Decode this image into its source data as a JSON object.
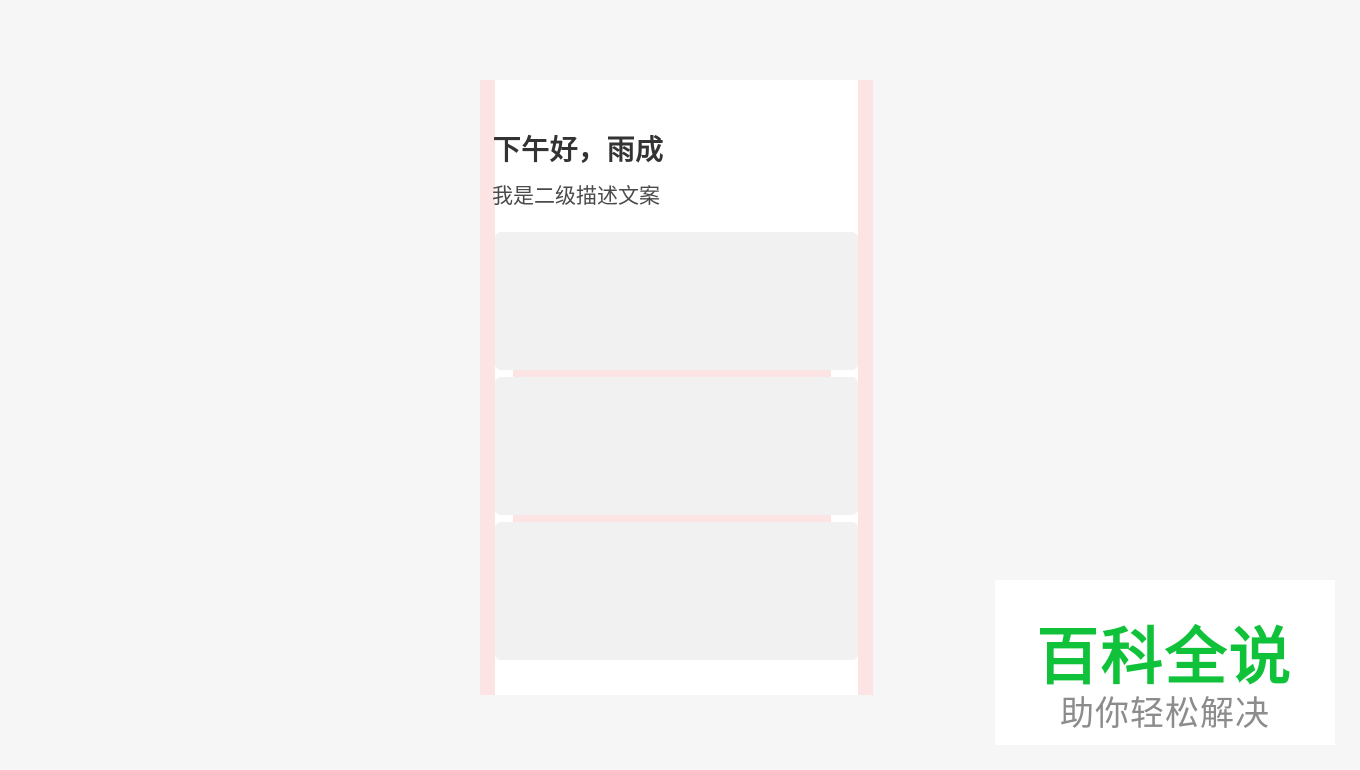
{
  "screen": {
    "greeting": "下午好，雨成",
    "subtitle": "我是二级描述文案",
    "cards": [
      "",
      "",
      ""
    ]
  },
  "watermark": {
    "title": "百科全说",
    "subtitle": "助你轻松解决",
    "title_color": "#10c23a",
    "subtitle_color": "#8c8c8c"
  },
  "colors": {
    "background": "#f6f6f6",
    "screen": "#ffffff",
    "guide": "#fde4e4",
    "card": "#f1f1f1",
    "text_primary": "#333333",
    "text_secondary": "#4a4a4a"
  }
}
